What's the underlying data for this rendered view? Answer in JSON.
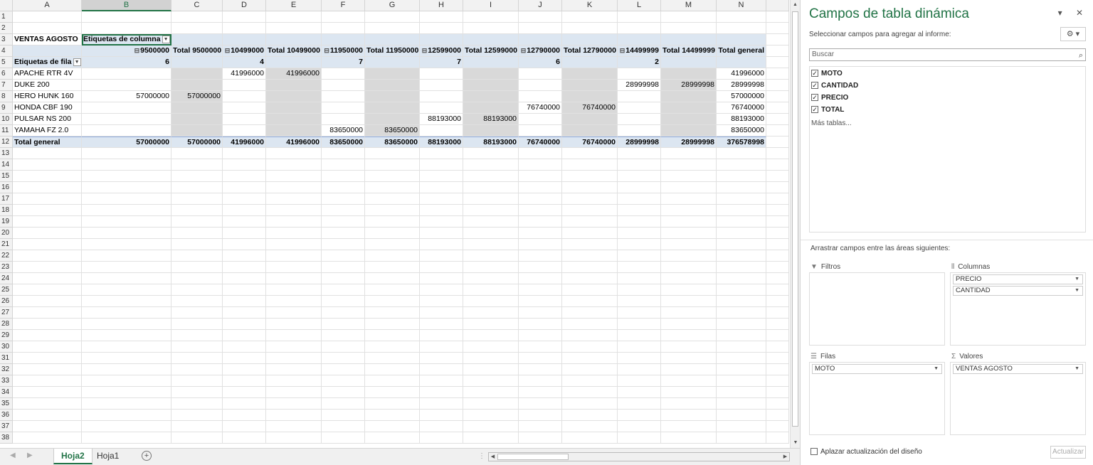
{
  "columns": [
    "A",
    "B",
    "C",
    "D",
    "E",
    "F",
    "G",
    "H",
    "I",
    "J",
    "K",
    "L",
    "M",
    "N"
  ],
  "rows": [
    "1",
    "2",
    "3",
    "4",
    "5",
    "6",
    "7",
    "8",
    "9",
    "10",
    "11",
    "12",
    "13",
    "14",
    "15",
    "16",
    "17",
    "18",
    "19",
    "20",
    "21",
    "22",
    "23",
    "24",
    "25",
    "26",
    "27",
    "28",
    "29",
    "30",
    "31",
    "32",
    "33",
    "34",
    "35",
    "36",
    "37",
    "38"
  ],
  "pivot": {
    "title": "VENTAS AGOSTO",
    "col_labels": "Etiquetas de columna",
    "row_labels": "Etiquetas de fila",
    "col_headers": [
      "9500000",
      "Total 9500000",
      "10499000",
      "Total 10499000",
      "11950000",
      "Total 11950000",
      "12599000",
      "Total 12599000",
      "12790000",
      "Total 12790000",
      "14499999",
      "Total 14499999",
      "Total general"
    ],
    "sub_headers": [
      "6",
      "",
      "4",
      "",
      "7",
      "",
      "7",
      "",
      "6",
      "",
      "2",
      "",
      ""
    ],
    "body": [
      {
        "label": "APACHE RTR 4V",
        "values": [
          "",
          "",
          "41996000",
          "41996000",
          "",
          "",
          "",
          "",
          "",
          "",
          "",
          "",
          "41996000"
        ]
      },
      {
        "label": "DUKE 200",
        "values": [
          "",
          "",
          "",
          "",
          "",
          "",
          "",
          "",
          "",
          "",
          "28999998",
          "28999998",
          "28999998"
        ]
      },
      {
        "label": "HERO HUNK 160",
        "values": [
          "57000000",
          "57000000",
          "",
          "",
          "",
          "",
          "",
          "",
          "",
          "",
          "",
          "",
          "57000000"
        ]
      },
      {
        "label": "HONDA CBF 190",
        "values": [
          "",
          "",
          "",
          "",
          "",
          "",
          "",
          "",
          "76740000",
          "76740000",
          "",
          "",
          "76740000"
        ]
      },
      {
        "label": "PULSAR NS 200",
        "values": [
          "",
          "",
          "",
          "",
          "",
          "",
          "88193000",
          "88193000",
          "",
          "",
          "",
          "",
          "88193000"
        ]
      },
      {
        "label": "YAMAHA FZ 2.0",
        "values": [
          "",
          "",
          "",
          "",
          "83650000",
          "83650000",
          "",
          "",
          "",
          "",
          "",
          "",
          "83650000"
        ]
      }
    ],
    "total_label": "Total general",
    "totals": [
      "57000000",
      "57000000",
      "41996000",
      "41996000",
      "83650000",
      "83650000",
      "88193000",
      "88193000",
      "76740000",
      "76740000",
      "28999998",
      "28999998",
      "376578998"
    ]
  },
  "sheet_tabs": [
    "Hoja2",
    "Hoja1"
  ],
  "active_tab": "Hoja2",
  "pane": {
    "title": "Campos de tabla dinámica",
    "subtitle": "Seleccionar campos para agregar al informe:",
    "search_placeholder": "Buscar",
    "fields": [
      "MOTO",
      "CANTIDAD",
      "PRECIO",
      "TOTAL"
    ],
    "more_tables": "Más tablas...",
    "drag_label": "Arrastrar campos entre las áreas siguientes:",
    "filters_label": "Filtros",
    "columns_label": "Columnas",
    "rows_label": "Filas",
    "values_label": "Valores",
    "columns_items": [
      "PRECIO",
      "CANTIDAD"
    ],
    "rows_items": [
      "MOTO"
    ],
    "values_items": [
      "VENTAS AGOSTO"
    ],
    "defer_label": "Aplazar actualización del diseño",
    "update_label": "Actualizar"
  }
}
